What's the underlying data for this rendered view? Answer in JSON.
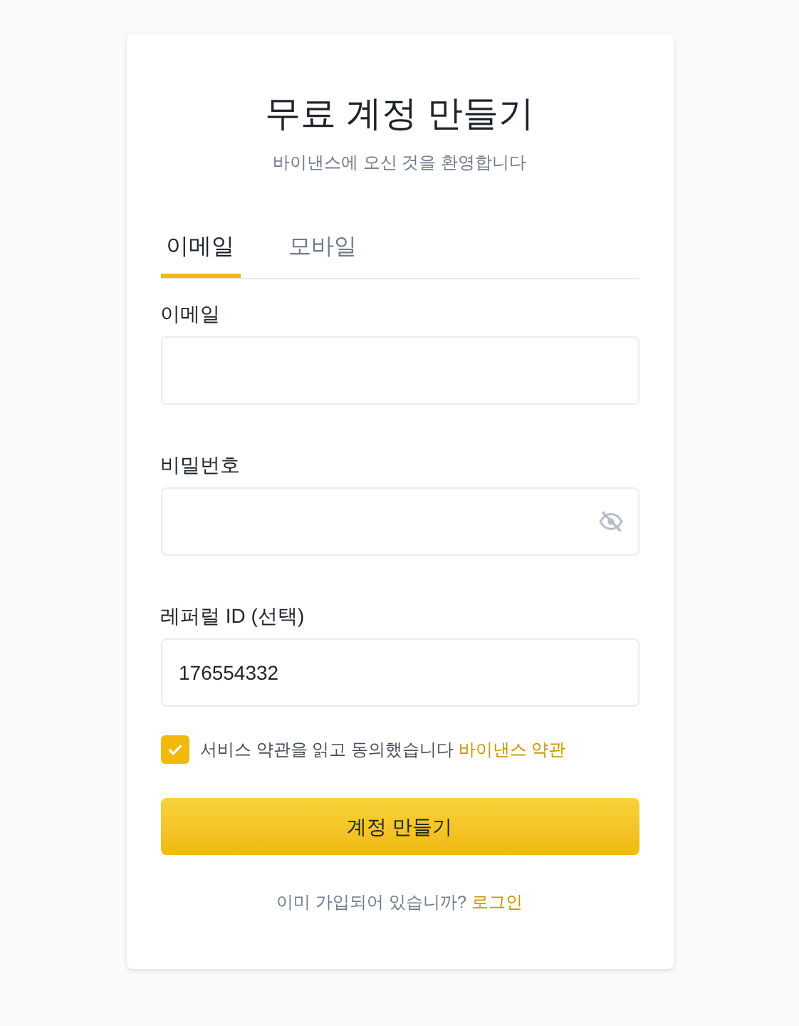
{
  "title": "무료 계정 만들기",
  "subtitle": "바이낸스에 오신 것을 환영합니다",
  "tabs": [
    {
      "label": "이메일",
      "selected": true
    },
    {
      "label": "모바일",
      "selected": false
    }
  ],
  "fields": [
    {
      "label": "이메일",
      "kind": "text"
    },
    {
      "label": "비밀번호",
      "kind": "password"
    },
    {
      "label": "레퍼럴 ID (선택)",
      "kind": "text",
      "value": "176554332"
    }
  ],
  "terms": {
    "checked": true,
    "text": "서비스 약관을 읽고 동의했습니다",
    "link": "바이낸스 약관"
  },
  "submit": "계정 만들기",
  "login": {
    "text": "이미 가입되어 있습니까?",
    "link": "로그인"
  }
}
